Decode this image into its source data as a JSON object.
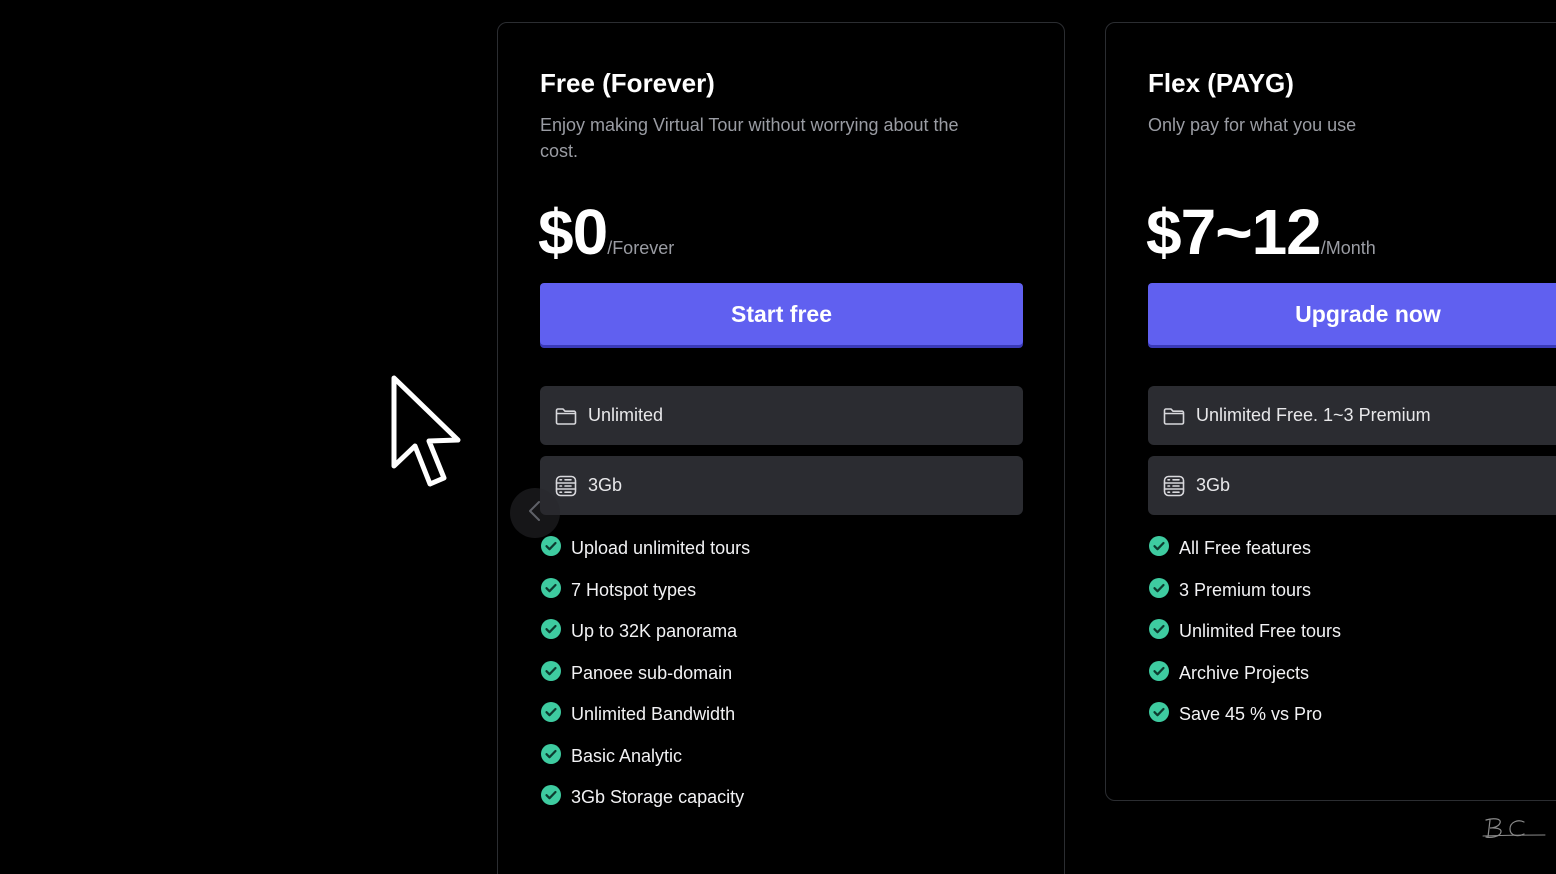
{
  "plans": [
    {
      "title": "Free (Forever)",
      "description": "Enjoy making Virtual Tour without worrying about the cost.",
      "price": "$0",
      "period": "/Forever",
      "cta_label": "Start free",
      "specs": [
        {
          "icon": "folder-icon",
          "label": "Unlimited"
        },
        {
          "icon": "storage-icon",
          "label": "3Gb"
        }
      ],
      "features": [
        "Upload unlimited tours",
        "7 Hotspot types",
        "Up to 32K panorama",
        "Panoee sub-domain",
        "Unlimited Bandwidth",
        "Basic Analytic",
        "3Gb Storage capacity"
      ]
    },
    {
      "title": "Flex (PAYG)",
      "description": "Only pay for what you use",
      "price": "$7~12",
      "period": "/Month",
      "cta_label": "Upgrade now",
      "specs": [
        {
          "icon": "folder-icon",
          "label": "Unlimited Free. 1~3 Premium"
        },
        {
          "icon": "storage-icon",
          "label": "3Gb"
        }
      ],
      "features": [
        "All Free features",
        "3 Premium tours",
        "Unlimited Free tours",
        "Archive Projects",
        "Save 45 % vs Pro"
      ]
    }
  ],
  "colors": {
    "background": "#000000",
    "card_border": "#2b2d31",
    "cta": "#6060f0",
    "spec_bg": "#2b2c31",
    "check": "#3ecba0",
    "muted_text": "#9a9ca3"
  },
  "icons": {
    "carousel_prev": "chevron-left-icon",
    "cursor": "mouse-pointer-icon",
    "check": "check-circle-icon"
  }
}
